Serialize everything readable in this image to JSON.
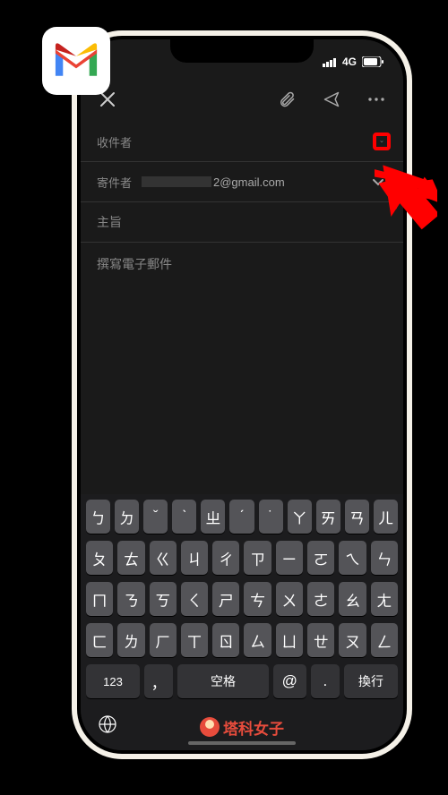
{
  "status": {
    "network": "4G"
  },
  "compose": {
    "to_label": "收件者",
    "from_label": "寄件者",
    "from_value_suffix": "2@gmail.com",
    "subject_label": "主旨",
    "body_placeholder": "撰寫電子郵件"
  },
  "keyboard": {
    "rows": [
      [
        "ㄅ",
        "ㄉ",
        "ˇ",
        "ˋ",
        "ㄓ",
        "ˊ",
        "˙",
        "ㄚ",
        "ㄞ",
        "ㄢ",
        "ㄦ"
      ],
      [
        "ㄆ",
        "ㄊ",
        "ㄍ",
        "ㄐ",
        "ㄔ",
        "ㄗ",
        "ㄧ",
        "ㄛ",
        "ㄟ",
        "ㄣ"
      ],
      [
        "ㄇ",
        "ㄋ",
        "ㄎ",
        "ㄑ",
        "ㄕ",
        "ㄘ",
        "ㄨ",
        "ㄜ",
        "ㄠ",
        "ㄤ"
      ],
      [
        "ㄈ",
        "ㄌ",
        "ㄏ",
        "ㄒ",
        "ㄖ",
        "ㄙ",
        "ㄩ",
        "ㄝ",
        "ㄡ",
        "ㄥ"
      ]
    ],
    "bottom": {
      "numbers": "123",
      "comma": "，",
      "space": "空格",
      "at": "@",
      "dot": ".",
      "return": "換行"
    }
  },
  "watermark": "塔科女子"
}
